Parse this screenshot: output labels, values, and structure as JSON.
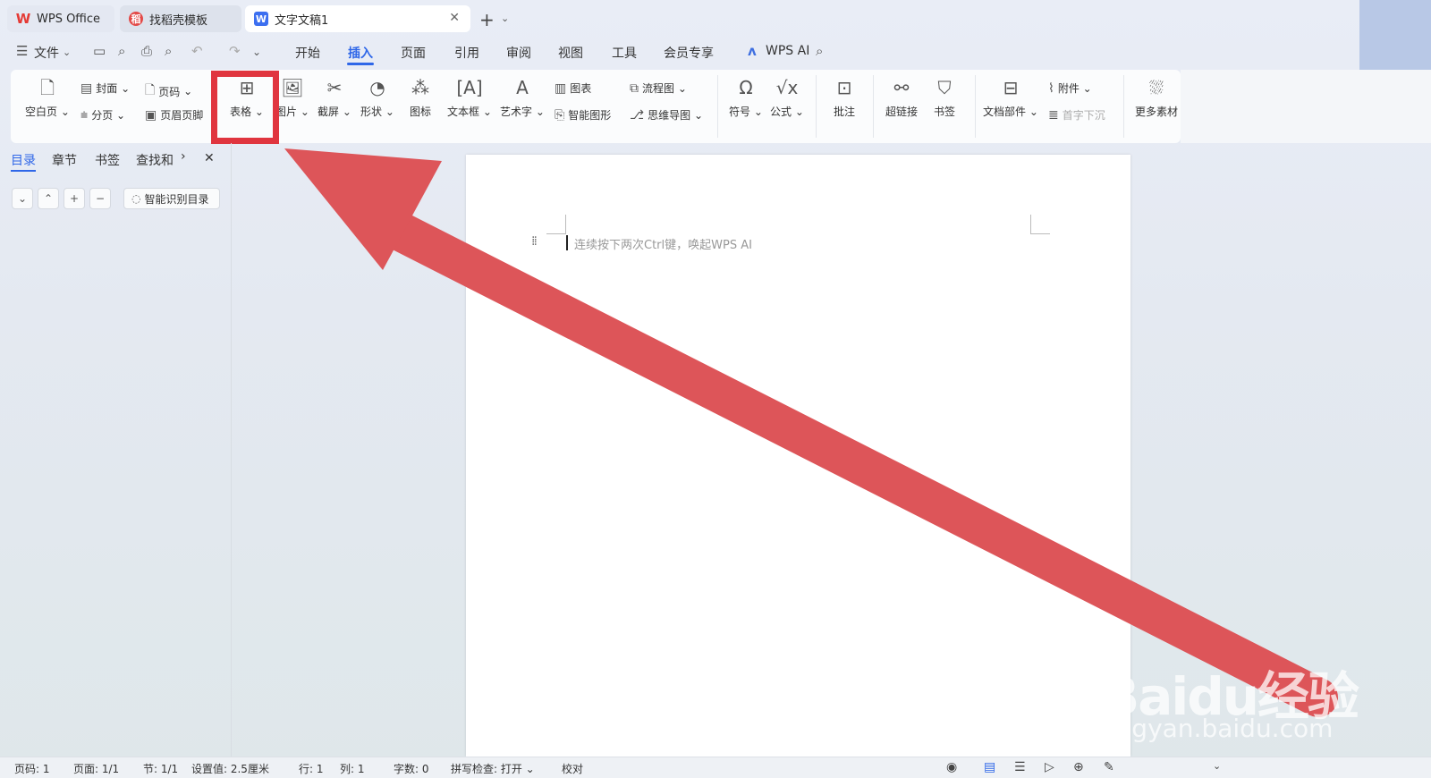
{
  "tabs": [
    {
      "label": "WPS Office",
      "icon": "wps-logo-icon"
    },
    {
      "label": "找稻壳模板",
      "icon": "docer-icon"
    },
    {
      "label": "文字文稿1",
      "icon": "writer-doc-icon",
      "close": "✕"
    }
  ],
  "menu": {
    "file": "文件",
    "items": [
      "开始",
      "插入",
      "页面",
      "引用",
      "审阅",
      "视图",
      "工具",
      "会员专享"
    ],
    "active": "插入",
    "ai": "WPS AI"
  },
  "ribbon": {
    "blank_page": "空白页",
    "cover": "封面",
    "page_break": "分页",
    "page_number": "页码",
    "header_footer": "页眉页脚",
    "table": "表格",
    "picture": "图片",
    "screenshot": "截屏",
    "shape": "形状",
    "icon": "图标",
    "textbox": "文本框",
    "wordart": "艺术字",
    "chart": "图表",
    "smartart": "智能图形",
    "flowchart": "流程图",
    "mindmap": "思维导图",
    "symbol": "符号",
    "formula": "公式",
    "comment": "批注",
    "hyperlink": "超链接",
    "bookmark": "书签",
    "doc_parts": "文档部件",
    "attachment": "附件",
    "dropcap": "首字下沉",
    "more_assets": "更多素材"
  },
  "left_panel": {
    "tabs": [
      "目录",
      "章节",
      "书签",
      "查找和"
    ],
    "smart_toc": "智能识别目录"
  },
  "document": {
    "hint": "连续按下两次Ctrl键，唤起WPS AI"
  },
  "status": {
    "page_num": "页码: 1",
    "pages": "页面: 1/1",
    "section": "节: 1/1",
    "setting": "设置值: 2.5厘米",
    "row": "行: 1",
    "col": "列: 1",
    "words": "字数: 0",
    "spell": "拼写检查: 打开",
    "proof": "校对"
  },
  "watermark": {
    "line1": "Baidu经验",
    "line2": "jingyan.baidu.com"
  },
  "colors": {
    "accent": "#2f67e8",
    "highlight": "#e0353f",
    "arrow": "#dd5559"
  }
}
